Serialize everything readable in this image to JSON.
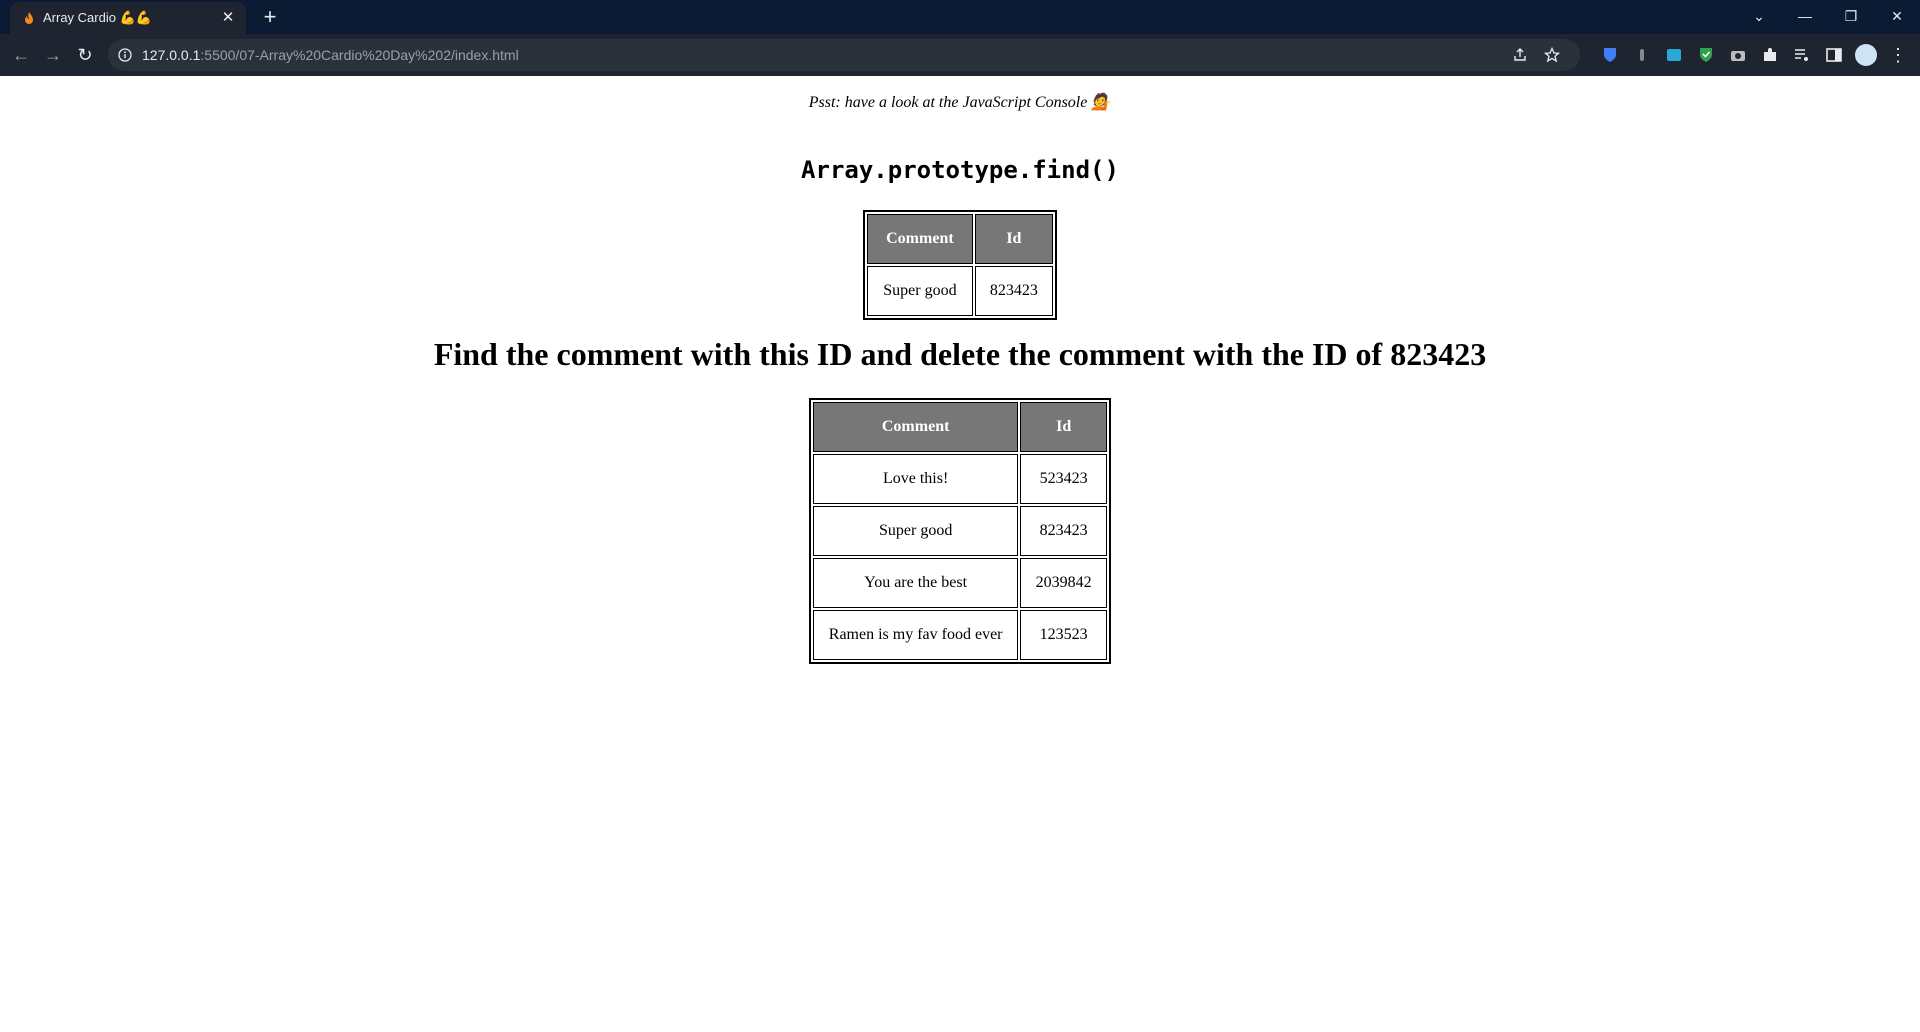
{
  "browser": {
    "tab_title": "Array Cardio 💪💪",
    "url_host": "127.0.0.1",
    "url_rest": ":5500/07-Array%20Cardio%20Day%202/index.html"
  },
  "page": {
    "psst": "Psst: have a look at the JavaScript Console 💁",
    "find_heading": "Array.prototype.find()",
    "find_table": {
      "headers": [
        "Comment",
        "Id"
      ],
      "rows": [
        [
          "Super good",
          "823423"
        ]
      ]
    },
    "delete_heading": "Find the comment with this ID and delete the comment with the ID of 823423",
    "comments_table": {
      "headers": [
        "Comment",
        "Id"
      ],
      "rows": [
        [
          "Love this!",
          "523423"
        ],
        [
          "Super good",
          "823423"
        ],
        [
          "You are the best",
          "2039842"
        ],
        [
          "Ramen is my fav food ever",
          "123523"
        ]
      ]
    }
  },
  "colors": {
    "tabstrip": "#0b1b33",
    "toolbar": "#1f2530",
    "table_header": "#777777"
  }
}
